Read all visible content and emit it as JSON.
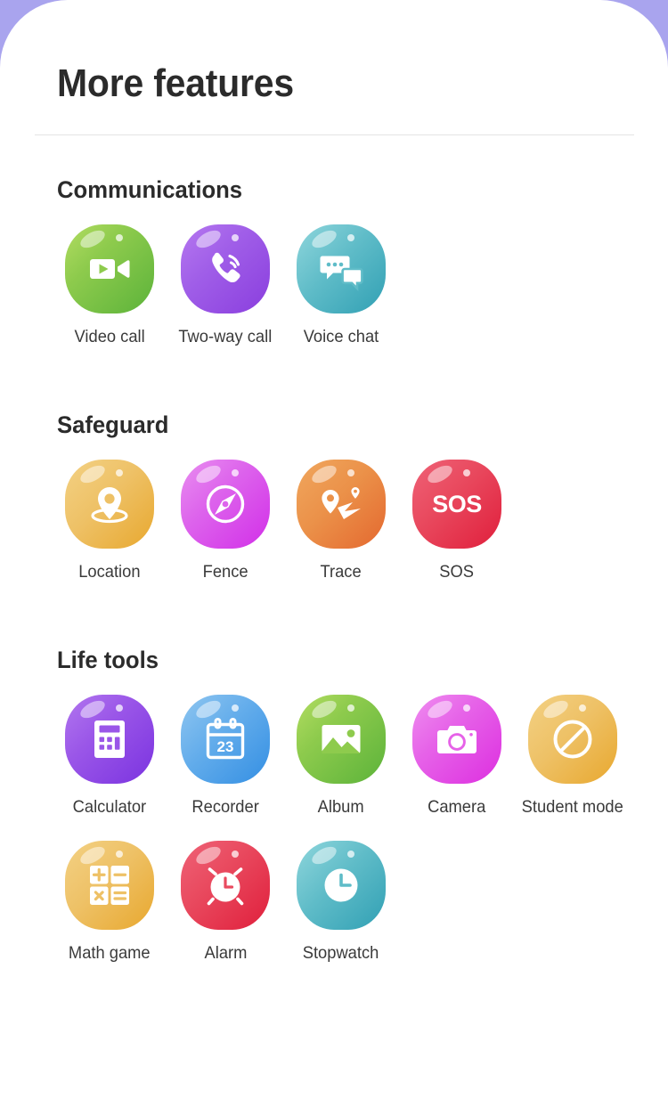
{
  "header": {
    "title": "More features"
  },
  "theme": {
    "background": "#a9a4ee",
    "card": "#ffffff",
    "title_color": "#2b2b2b",
    "label_color": "#3a3a3a",
    "divider": "#e3e3e3"
  },
  "sections": [
    {
      "title": "Communications",
      "tiles": [
        {
          "label": "Video call",
          "icon": "video-camera-icon",
          "color": "#8ecb4d"
        },
        {
          "label": "Two-way call",
          "icon": "phone-call-icon",
          "color": "#a05ee8"
        },
        {
          "label": "Voice chat",
          "icon": "chat-bubbles-icon",
          "color": "#5fbcc8"
        }
      ]
    },
    {
      "title": "Safeguard",
      "tiles": [
        {
          "label": "Location",
          "icon": "map-pin-icon",
          "color": "#eec166"
        },
        {
          "label": "Fence",
          "icon": "compass-icon",
          "color": "#dd64ec"
        },
        {
          "label": "Trace",
          "icon": "route-map-icon",
          "color": "#eb9149"
        },
        {
          "label": "SOS",
          "icon": "sos-text-icon",
          "color": "#e94a5f"
        }
      ]
    },
    {
      "title": "Life tools",
      "tiles": [
        {
          "label": "Calculator",
          "icon": "calculator-icon",
          "color": "#9a56e8"
        },
        {
          "label": "Recorder",
          "icon": "calendar-23-icon",
          "color": "#62aceb"
        },
        {
          "label": "Album",
          "icon": "photo-image-icon",
          "color": "#8ecb4d"
        },
        {
          "label": "Camera",
          "icon": "camera-icon",
          "color": "#e662e8"
        },
        {
          "label": "Student mode",
          "icon": "prohibited-icon",
          "color": "#eec166"
        },
        {
          "label": "Math game",
          "icon": "math-operators-icon",
          "color": "#eec166"
        },
        {
          "label": "Alarm",
          "icon": "alarm-clock-icon",
          "color": "#e94a5f"
        },
        {
          "label": "Stopwatch",
          "icon": "clock-icon",
          "color": "#5fbcc8"
        }
      ]
    }
  ]
}
